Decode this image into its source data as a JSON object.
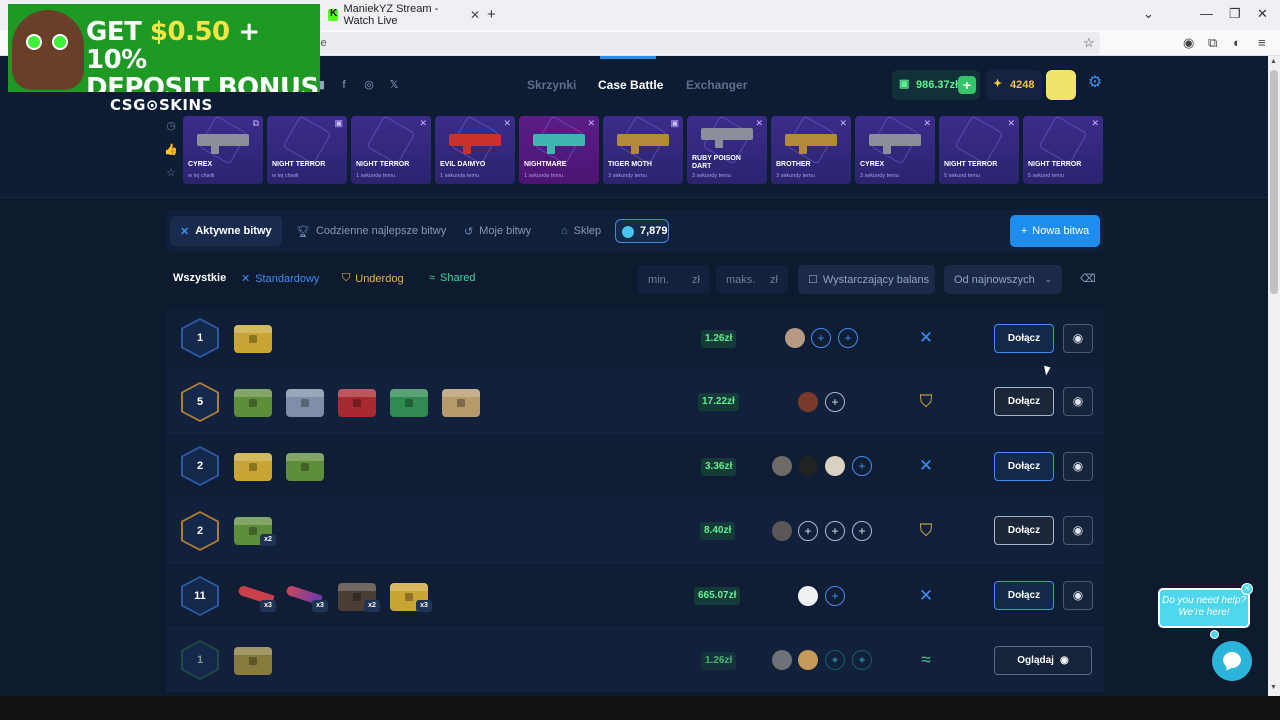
{
  "browser": {
    "tab_title": "ManiekYZ Stream - Watch Live",
    "url": "le"
  },
  "promo": {
    "line1_prefix": "GET ",
    "line1_highlight": "$0.50",
    "line1_suffix": " + 10%",
    "line2": "DEPOSIT BONUS",
    "brand": "CSG⊙SKINS"
  },
  "header": {
    "nav": [
      "Skrzynki",
      "Case Battle",
      "Exchanger"
    ],
    "balance": "986.37zł",
    "coins": "4248"
  },
  "drops": [
    {
      "name": "CYREX",
      "time": "w tej chwili"
    },
    {
      "name": "NIGHT TERROR",
      "time": "w tej chwili"
    },
    {
      "name": "NIGHT TERROR",
      "time": "1 sekundę temu"
    },
    {
      "name": "EVIL DAIMYO",
      "time": "1 sekundę temu"
    },
    {
      "name": "NIGHTMARE",
      "time": "1 sekundę temu"
    },
    {
      "name": "TIGER MOTH",
      "time": "3 sekundy temu"
    },
    {
      "name": "RUBY POISON DART",
      "time": "3 sekundy temu"
    },
    {
      "name": "BROTHER",
      "time": "3 sekundy temu"
    },
    {
      "name": "CYREX",
      "time": "3 sekundy temu"
    },
    {
      "name": "NIGHT TERROR",
      "time": "5 sekund temu"
    },
    {
      "name": "NIGHT TERROR",
      "time": "5 sekund temu"
    }
  ],
  "tabs": {
    "active": "Aktywne bitwy",
    "daily": "Codzienne najlepsze bitwy",
    "mine": "Moje bitwy",
    "shop": "Sklep",
    "gems": "7,879",
    "new_battle": "Nowa bitwa"
  },
  "filters": {
    "all": "Wszystkie",
    "standard": "Standardowy",
    "underdog": "Underdog",
    "shared": "Shared",
    "min_placeholder": "min.",
    "max_placeholder": "maks.",
    "currency": "zł",
    "enough_balance": "Wystarczający balans",
    "sort": "Od najnowszych"
  },
  "battles": [
    {
      "level": "1",
      "price": "1.26zł",
      "mode": "standard",
      "join": "Dołącz"
    },
    {
      "level": "5",
      "price": "17.22zł",
      "mode": "underdog",
      "join": "Dołącz"
    },
    {
      "level": "2",
      "price": "3.36zł",
      "mode": "standard",
      "join": "Dołącz"
    },
    {
      "level": "2",
      "price": "8.40zł",
      "mode": "underdog",
      "join": "Dołącz",
      "multiplier": "x2"
    },
    {
      "level": "11",
      "price": "665.07zł",
      "mode": "standard",
      "join": "Dołącz",
      "multipliers": [
        "x3",
        "x3",
        "x2",
        "x3"
      ]
    },
    {
      "level": "1",
      "price": "1.26zł",
      "mode": "shared",
      "watch": "Oglądaj"
    }
  ],
  "help": {
    "line1": "Do you need help?",
    "line2": "We're here!"
  }
}
